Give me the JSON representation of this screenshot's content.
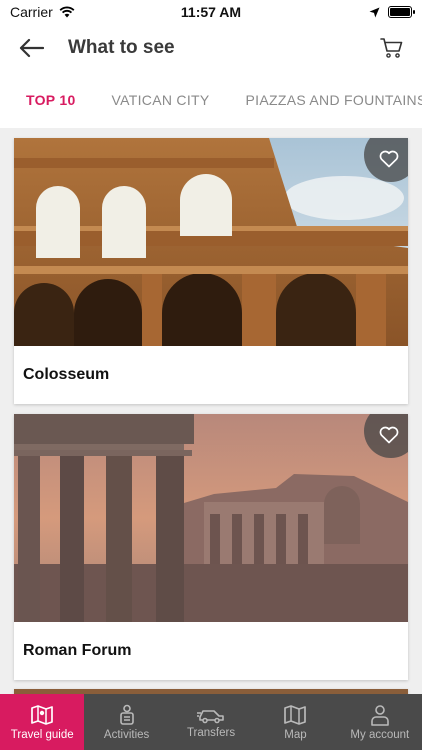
{
  "status": {
    "carrier": "Carrier",
    "time": "11:57 AM"
  },
  "header": {
    "title": "What to see"
  },
  "tabs": [
    {
      "label": "TOP 10",
      "active": true
    },
    {
      "label": "VATICAN CITY",
      "active": false
    },
    {
      "label": "PIAZZAS AND FOUNTAINS",
      "active": false
    }
  ],
  "cards": [
    {
      "title": "Colosseum",
      "image_icon": "colosseum-photo"
    },
    {
      "title": "Roman Forum",
      "image_icon": "roman-forum-photo"
    }
  ],
  "bottom_nav": [
    {
      "label": "Travel guide",
      "icon": "map-book-icon",
      "active": true
    },
    {
      "label": "Activities",
      "icon": "traveler-icon",
      "active": false
    },
    {
      "label": "Transfers",
      "icon": "car-icon",
      "active": false
    },
    {
      "label": "Map",
      "icon": "map-icon",
      "active": false
    },
    {
      "label": "My account",
      "icon": "user-icon",
      "active": false
    }
  ],
  "colors": {
    "accent": "#d81b60",
    "nav_bg": "#4a4a4a",
    "page_bg": "#efefef"
  }
}
